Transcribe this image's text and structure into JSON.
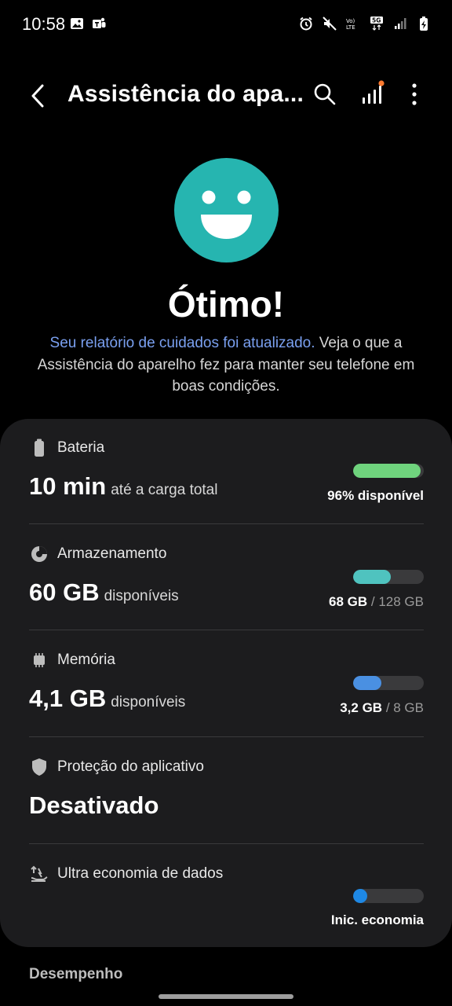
{
  "status": {
    "time": "10:58"
  },
  "appbar": {
    "title": "Assistência do apa..."
  },
  "hero": {
    "title": "Ótimo!",
    "link_text": "Seu relatório de cuidados foi atualizado.",
    "desc_text": " Veja o que a Assistência do aparelho fez para manter seu telefone em boas condições."
  },
  "sections": {
    "battery": {
      "label": "Bateria",
      "value": "10 min",
      "value_suffix": "até a carga total",
      "status": "96% disponível",
      "level": 0.96,
      "color": "#6fd37d"
    },
    "storage": {
      "label": "Armazenamento",
      "value": "60 GB",
      "value_suffix": "disponíveis",
      "used": "68 GB",
      "total": "/ 128 GB",
      "level": 0.53,
      "color": "#4fc3bf"
    },
    "memory": {
      "label": "Memória",
      "value": "4,1 GB",
      "value_suffix": "disponíveis",
      "used": "3,2 GB",
      "total": "/ 8 GB",
      "level": 0.4,
      "color": "#4a90e2"
    },
    "protection": {
      "label": "Proteção do aplicativo",
      "value": "Desativado"
    },
    "datasaver": {
      "label": "Ultra economia de dados",
      "status": "Inic. economia",
      "level": 0.0,
      "color": "#1e88e5"
    }
  },
  "footer": {
    "section_label": "Desempenho"
  },
  "colors": {
    "accent": "#26b5b0",
    "link": "#7aa0f0",
    "card": "#1c1c1e"
  }
}
